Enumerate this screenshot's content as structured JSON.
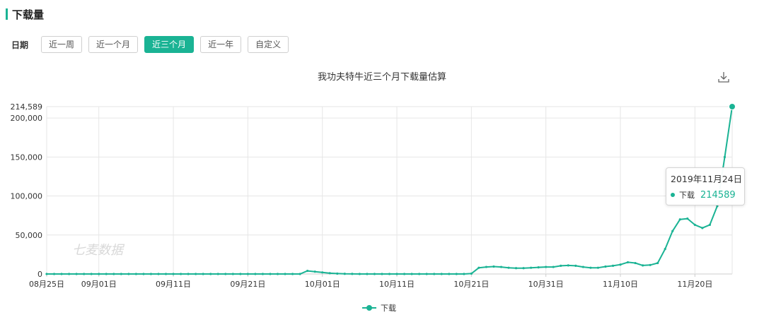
{
  "header": {
    "title": "下载量"
  },
  "date_filter": {
    "label": "日期",
    "options": [
      "近一周",
      "近一个月",
      "近三个月",
      "近一年",
      "自定义"
    ],
    "active_index": 2
  },
  "chart_data": {
    "type": "line",
    "title": "我功夫特牛近三个月下载量估算",
    "x_start": "2019-08-25",
    "x": [
      "08-25",
      "08-26",
      "08-27",
      "08-28",
      "08-29",
      "08-30",
      "08-31",
      "09-01",
      "09-02",
      "09-03",
      "09-04",
      "09-05",
      "09-06",
      "09-07",
      "09-08",
      "09-09",
      "09-10",
      "09-11",
      "09-12",
      "09-13",
      "09-14",
      "09-15",
      "09-16",
      "09-17",
      "09-18",
      "09-19",
      "09-20",
      "09-21",
      "09-22",
      "09-23",
      "09-24",
      "09-25",
      "09-26",
      "09-27",
      "09-28",
      "09-29",
      "09-30",
      "10-01",
      "10-02",
      "10-03",
      "10-04",
      "10-05",
      "10-06",
      "10-07",
      "10-08",
      "10-09",
      "10-10",
      "10-11",
      "10-12",
      "10-13",
      "10-14",
      "10-15",
      "10-16",
      "10-17",
      "10-18",
      "10-19",
      "10-20",
      "10-21",
      "10-22",
      "10-23",
      "10-24",
      "10-25",
      "10-26",
      "10-27",
      "10-28",
      "10-29",
      "10-30",
      "10-31",
      "11-01",
      "11-02",
      "11-03",
      "11-04",
      "11-05",
      "11-06",
      "11-07",
      "11-08",
      "11-09",
      "11-10",
      "11-11",
      "11-12",
      "11-13",
      "11-14",
      "11-15",
      "11-16",
      "11-17",
      "11-18",
      "11-19",
      "11-20",
      "11-21",
      "11-22",
      "11-23",
      "11-24"
    ],
    "x_tick_labels": [
      "08月25日",
      "09月01日",
      "09月11日",
      "09月21日",
      "10月01日",
      "10月11日",
      "10月21日",
      "10月31日",
      "11月10日",
      "11月20日"
    ],
    "x_tick_dates": [
      "08-25",
      "09-01",
      "09-11",
      "09-21",
      "10-01",
      "10-11",
      "10-21",
      "10-31",
      "11-10",
      "11-20"
    ],
    "series": [
      {
        "name": "下载",
        "values": [
          0,
          0,
          0,
          0,
          0,
          0,
          0,
          0,
          0,
          0,
          0,
          0,
          0,
          0,
          0,
          0,
          0,
          0,
          0,
          0,
          0,
          0,
          0,
          0,
          0,
          0,
          0,
          0,
          0,
          0,
          0,
          0,
          0,
          0,
          0,
          4000,
          3000,
          2000,
          1000,
          500,
          200,
          100,
          0,
          0,
          0,
          0,
          0,
          0,
          0,
          0,
          0,
          0,
          0,
          0,
          0,
          0,
          0,
          500,
          8000,
          9000,
          9500,
          9000,
          8000,
          7500,
          7500,
          8000,
          8500,
          9000,
          9000,
          10500,
          11000,
          10500,
          9000,
          8000,
          8000,
          9500,
          10500,
          12000,
          15000,
          14000,
          11000,
          11500,
          14000,
          32000,
          55000,
          70000,
          71000,
          63000,
          59000,
          63000,
          87000,
          150000,
          214589
        ]
      }
    ],
    "y_ticks": [
      0,
      50000,
      100000,
      150000,
      200000,
      214589
    ],
    "y_tick_labels": [
      "0",
      "50,000",
      "100,000",
      "150,000",
      "200,000",
      "214,589"
    ],
    "ylim": [
      0,
      214589
    ],
    "legend": "bottom-center",
    "grid": true,
    "colors": {
      "line": "#1ab394",
      "grid": "#e6e6e6",
      "axis": "#cccccc"
    },
    "tooltip": {
      "date": "2019年11月24日",
      "series": "下载",
      "value": "214589"
    },
    "watermark": "七麦数据"
  },
  "icons": {
    "download": "download-icon"
  }
}
